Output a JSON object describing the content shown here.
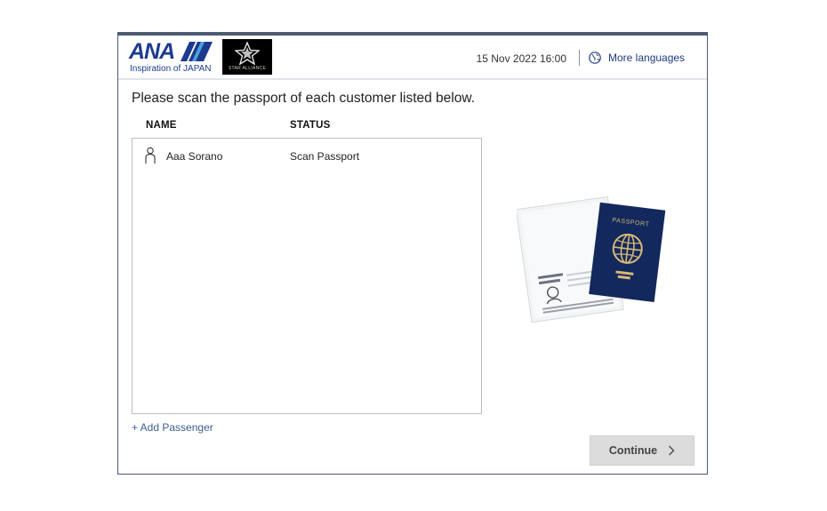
{
  "header": {
    "brand_name": "ANA",
    "brand_tagline": "Inspiration of JAPAN",
    "alliance_name": "STAR ALLIANCE",
    "datetime": "15 Nov 2022 16:00",
    "language_label": "More languages",
    "language_icon": "globe-icon"
  },
  "main": {
    "instruction": "Please scan the passport of each customer listed below.",
    "columns": {
      "name": "NAME",
      "status": "STATUS"
    },
    "passengers": [
      {
        "name": "Aaa Sorano",
        "status": "Scan Passport",
        "icon": "person-icon"
      }
    ],
    "add_passenger_label": "+ Add Passenger",
    "continue_label": "Continue",
    "passport_label": "PASSPORT"
  },
  "colors": {
    "brand_blue": "#1c3b8f",
    "frame_border": "#4d5b74",
    "link_blue": "#3b5f8e",
    "passport_navy": "#13285c",
    "button_gray": "#dcdcdc"
  }
}
